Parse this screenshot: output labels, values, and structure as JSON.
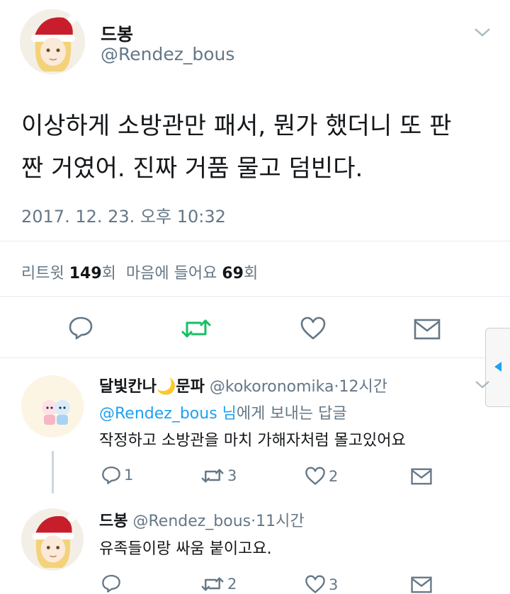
{
  "main_tweet": {
    "display_name": "드봉",
    "handle": "@Rendez_bous",
    "text_line1": "이상하게 소방관만 패서, 뭔가 했더니 또 판",
    "text_line2": "짠 거였어. 진짜 거품 물고 덤빈다.",
    "timestamp": "2017. 12. 23. 오후 10:32",
    "stats": {
      "retweet_label": "리트윗",
      "retweet_count": "149",
      "retweet_suffix": "회",
      "like_label": "마음에 들어요",
      "like_count": "69",
      "like_suffix": "회"
    }
  },
  "reply1": {
    "display_name": "달빛칸나",
    "name_emoji": "🌙",
    "display_name2": "문파",
    "handle": "@kokoronomika",
    "dot": "·",
    "time": "12시간",
    "replying_to_handle": "@Rendez_bous 님",
    "replying_to_suffix": "에게 보내는 답글",
    "text": "작정하고 소방관을 마치 가해자처럼 몰고있어요",
    "reply_count": "1",
    "retweet_count": "3",
    "like_count": "2"
  },
  "reply2": {
    "display_name": "드봉",
    "handle": "@Rendez_bous",
    "dot": "·",
    "time": "11시간",
    "text": "유족들이랑 싸움 붙이고요.",
    "retweet_count": "2",
    "like_count": "3"
  },
  "colors": {
    "retweet_active": "#17bf63",
    "link": "#1da1f2",
    "muted": "#657786",
    "text": "#14171a"
  }
}
